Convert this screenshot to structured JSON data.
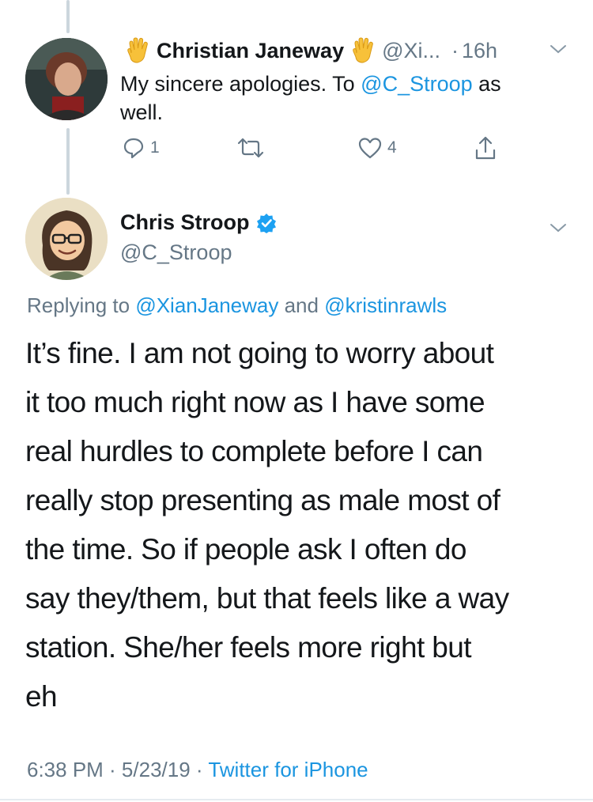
{
  "reply_tweet": {
    "display_name": "Christian Janeway",
    "handle": "@Xi...",
    "separator": "·",
    "time": "16h",
    "text_prefix": "My sincere apologies. To ",
    "mention": "@C_Stroop",
    "text_suffix_line1": " as",
    "text_line2": "well.",
    "actions": {
      "reply_count": "1",
      "retweet_count": "",
      "like_count": "4"
    },
    "name_emoji": "vulcan-salute-emoji"
  },
  "main_tweet": {
    "display_name": "Chris Stroop",
    "handle": "@C_Stroop",
    "verified": true,
    "replying_prefix": "Replying to ",
    "replying_mention_1": "@XianJaneway",
    "replying_and": " and ",
    "replying_mention_2": "@kristinrawls",
    "text_lines": [
      "It’s fine. I am not going to worry about",
      "it too much right now as I have some",
      "real hurdles to complete before I can",
      "really stop presenting as male most of",
      "the time. So if people ask I often do",
      "say they/them, but that feels like a way",
      "station. She/her feels more right but",
      "eh"
    ],
    "timestamp": "6:38 PM · 5/23/19 · ",
    "source": "Twitter for iPhone"
  },
  "colors": {
    "link": "#1b95e0",
    "secondary": "#657786",
    "verified": "#1da1f2",
    "thread_line": "#ccd6dd",
    "divider": "#e6ecf0"
  }
}
